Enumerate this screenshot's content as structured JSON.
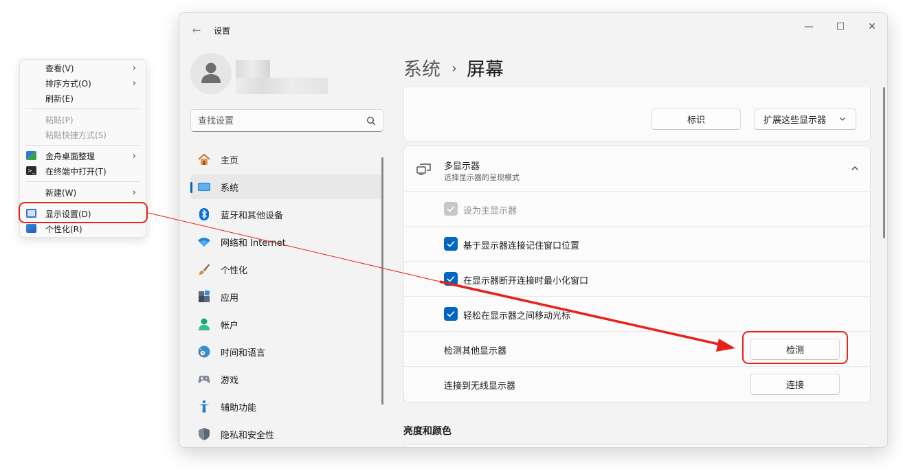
{
  "context_menu": {
    "items": [
      {
        "label": "查看(V)",
        "has_submenu": true,
        "disabled": false
      },
      {
        "label": "排序方式(O)",
        "has_submenu": true,
        "disabled": false
      },
      {
        "label": "刷新(E)",
        "has_submenu": false,
        "disabled": false
      },
      {
        "label": "粘贴(P)",
        "has_submenu": false,
        "disabled": true
      },
      {
        "label": "粘贴快捷方式(S)",
        "has_submenu": false,
        "disabled": true
      },
      {
        "label": "金舟桌面整理",
        "has_submenu": true,
        "disabled": false,
        "icon": "jinzhou-app-icon"
      },
      {
        "label": "在终端中打开(T)",
        "has_submenu": false,
        "disabled": false,
        "icon": "terminal-icon"
      },
      {
        "label": "新建(W)",
        "has_submenu": true,
        "disabled": false
      },
      {
        "label": "显示设置(D)",
        "has_submenu": false,
        "disabled": false,
        "icon": "display-icon"
      },
      {
        "label": "个性化(R)",
        "has_submenu": false,
        "disabled": false,
        "icon": "personalize-icon"
      }
    ],
    "arrow_glyph": "›"
  },
  "window": {
    "title": "设置",
    "back_glyph": "←",
    "min_glyph": "—",
    "max_glyph": "☐",
    "close_glyph": "✕"
  },
  "search": {
    "placeholder": "查找设置"
  },
  "nav": {
    "items": [
      {
        "label": "主页",
        "icon": "home-icon"
      },
      {
        "label": "系统",
        "icon": "system-icon",
        "active": true
      },
      {
        "label": "蓝牙和其他设备",
        "icon": "bluetooth-icon"
      },
      {
        "label": "网络和 Internet",
        "icon": "wifi-icon"
      },
      {
        "label": "个性化",
        "icon": "brush-icon"
      },
      {
        "label": "应用",
        "icon": "apps-icon"
      },
      {
        "label": "帐户",
        "icon": "account-icon"
      },
      {
        "label": "时间和语言",
        "icon": "globe-clock-icon"
      },
      {
        "label": "游戏",
        "icon": "gamepad-icon"
      },
      {
        "label": "辅助功能",
        "icon": "accessibility-icon"
      },
      {
        "label": "隐私和安全性",
        "icon": "shield-icon"
      }
    ]
  },
  "breadcrumb": {
    "parent": "系统",
    "separator": "›",
    "current": "屏幕"
  },
  "top_card": {
    "identify_label": "标识",
    "extend_label": "扩展这些显示器"
  },
  "multi_display": {
    "title": "多显示器",
    "subtitle": "选择显示器的呈现模式",
    "expanded": true,
    "rows": [
      {
        "label": "设为主显示器",
        "type": "checkbox",
        "checked": true,
        "disabled": true
      },
      {
        "label": "基于显示器连接记住窗口位置",
        "type": "checkbox",
        "checked": true,
        "disabled": false
      },
      {
        "label": "在显示器断开连接时最小化窗口",
        "type": "checkbox",
        "checked": true,
        "disabled": false
      },
      {
        "label": "轻松在显示器之间移动光标",
        "type": "checkbox",
        "checked": true,
        "disabled": false
      },
      {
        "label": "检测其他显示器",
        "type": "button",
        "button_label": "检测"
      },
      {
        "label": "连接到无线显示器",
        "type": "button",
        "button_label": "连接"
      }
    ]
  },
  "brightness_section": {
    "title": "亮度和颜色"
  },
  "colors": {
    "accent": "#0067c0",
    "annotation": "#e8201a"
  }
}
